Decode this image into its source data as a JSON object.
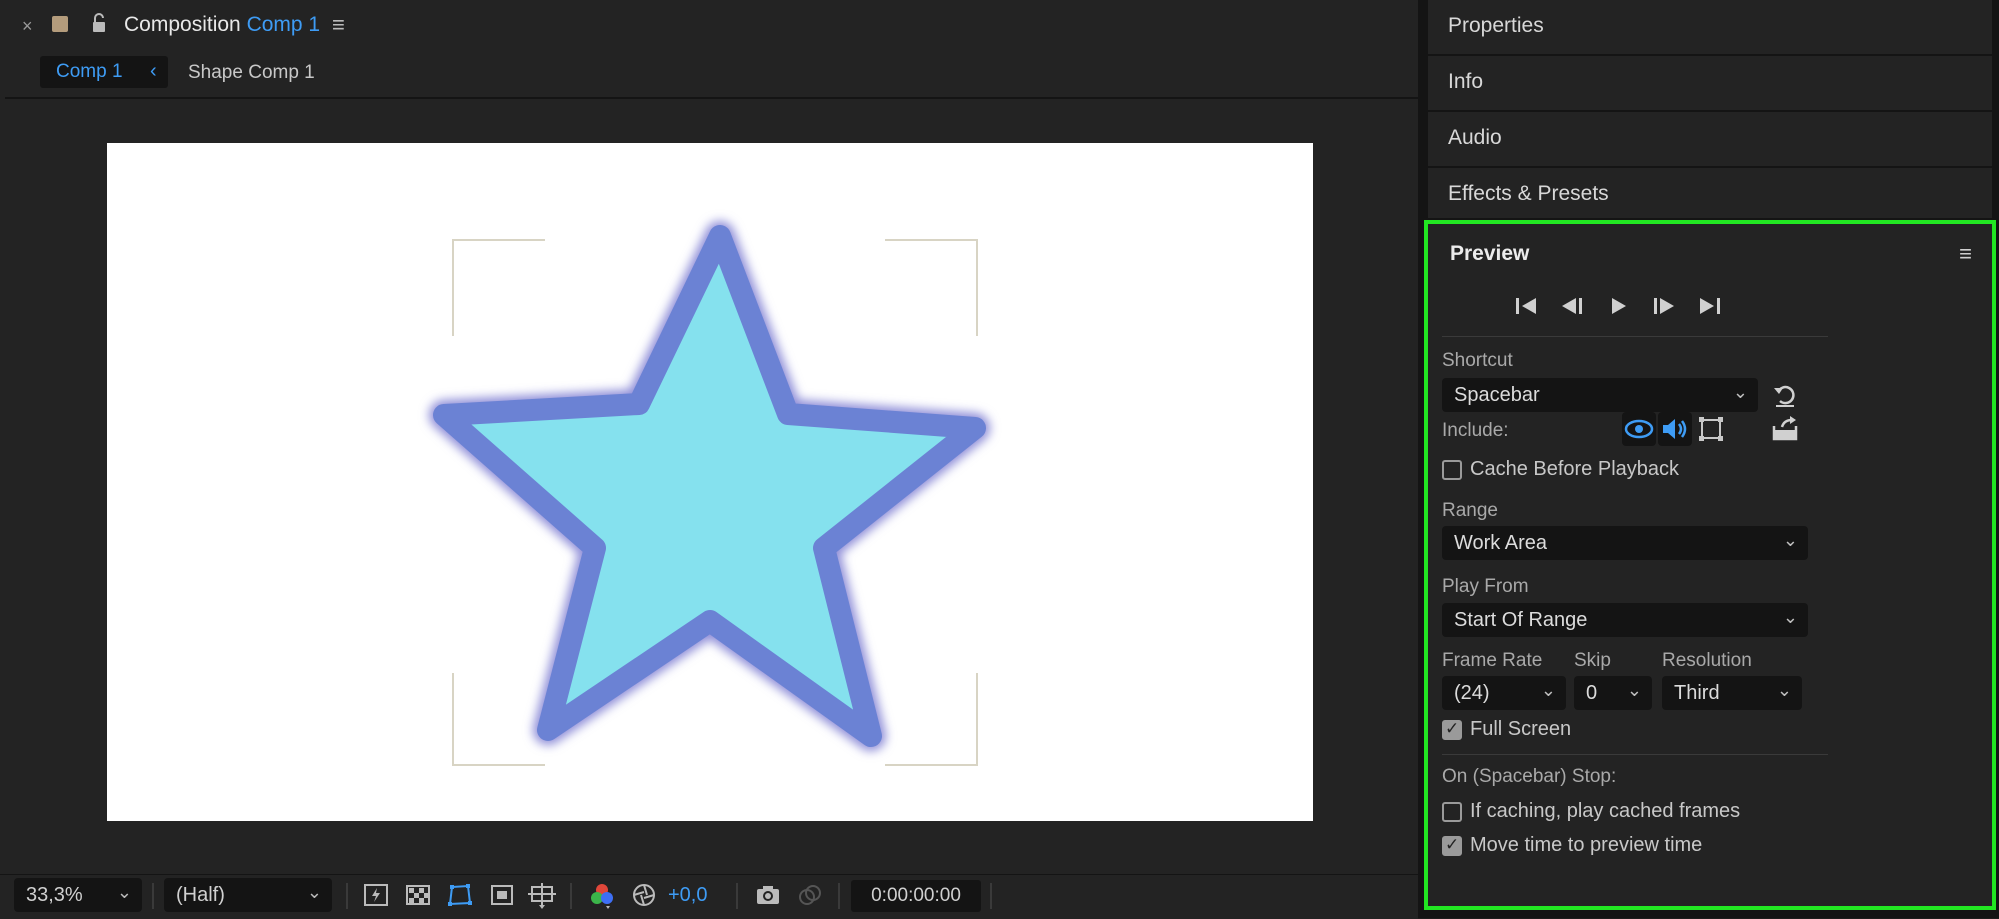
{
  "composition": {
    "title_prefix": "Composition",
    "title_comp": "Comp 1",
    "tabs": {
      "active": "Comp 1",
      "next": "Shape Comp 1"
    }
  },
  "toolbar": {
    "zoom": "33,3%",
    "resolution": "(Half)",
    "exposure": "+0,0",
    "timecode": "0:00:00:00"
  },
  "side_tabs": [
    "Properties",
    "Info",
    "Audio",
    "Effects & Presets"
  ],
  "preview": {
    "title": "Preview",
    "shortcut_label": "Shortcut",
    "shortcut_value": "Spacebar",
    "include_label": "Include:",
    "cache_before_playback": "Cache Before Playback",
    "range_label": "Range",
    "range_value": "Work Area",
    "play_from_label": "Play From",
    "play_from_value": "Start Of Range",
    "frame_rate_label": "Frame Rate",
    "frame_rate_value": "(24)",
    "skip_label": "Skip",
    "skip_value": "0",
    "resolution_label": "Resolution",
    "resolution_value": "Third",
    "full_screen": "Full Screen",
    "on_stop_label": "On (Spacebar) Stop:",
    "if_caching": "If caching, play cached frames",
    "move_time": "Move time to preview time",
    "checks": {
      "cache_before_playback": false,
      "full_screen": true,
      "if_caching": false,
      "move_time": true
    }
  },
  "colors": {
    "accent": "#3e9cf5",
    "highlight": "#22e622",
    "star_fill": "#85e1ee",
    "star_stroke": "#6b82d4"
  }
}
